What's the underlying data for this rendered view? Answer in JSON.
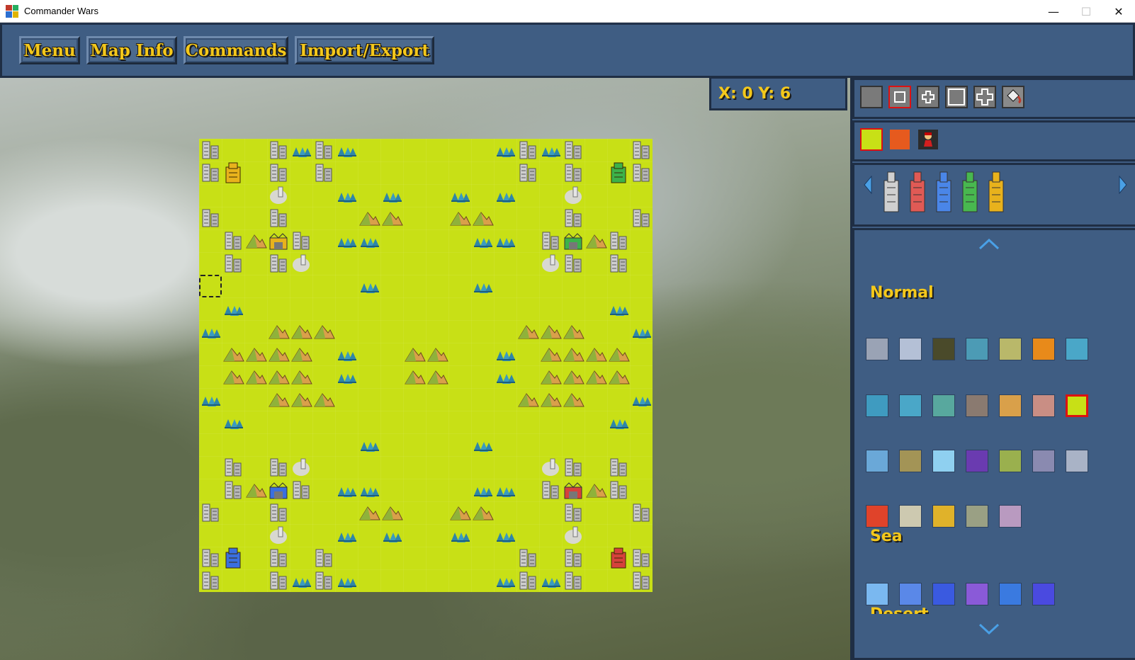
{
  "window": {
    "title": "Commander Wars"
  },
  "window_controls": {
    "minimize": "—",
    "maximize": "☐",
    "close": "✕"
  },
  "toolbar": {
    "menu": "Menu",
    "map_info": "Map Info",
    "commands": "Commands",
    "import_export": "Import/Export"
  },
  "cursor": {
    "coords": "X: 0 Y: 6"
  },
  "palette": {
    "categories": [
      "Normal",
      "Sea",
      "Desert"
    ]
  },
  "colors": {
    "panel": "#3f5d83",
    "accent": "#f4c81b",
    "plains": "#c8e016"
  }
}
